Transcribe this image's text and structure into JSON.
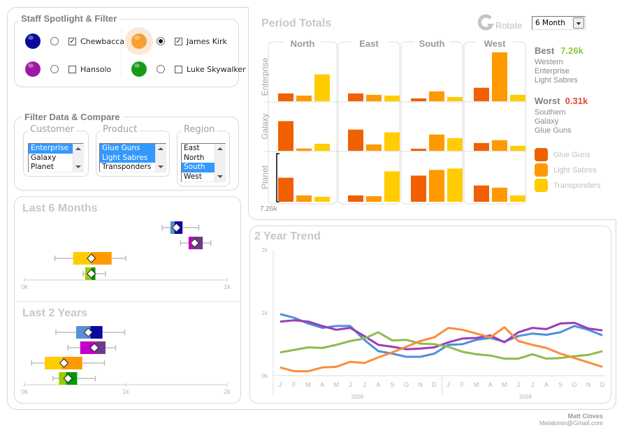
{
  "staff": {
    "title": "Staff Spotlight & Filter",
    "members": [
      {
        "name": "Chewbacca",
        "color": "#0a0a9a",
        "selected": false,
        "checked": true
      },
      {
        "name": "Hansolo",
        "color": "#a018a8",
        "selected": false,
        "checked": false
      },
      {
        "name": "James Kirk",
        "color": "#f5a030",
        "selected": true,
        "checked": true
      },
      {
        "name": "Luke Skywalker",
        "color": "#1a9a1a",
        "selected": false,
        "checked": false
      }
    ],
    "check_mark": "✓"
  },
  "filter": {
    "title": "Filter Data & Compare",
    "customer": {
      "label": "Customer",
      "options": [
        {
          "text": "Enterprise",
          "selected": true
        },
        {
          "text": "Galaxy",
          "selected": false
        },
        {
          "text": "Planet",
          "selected": false
        }
      ]
    },
    "product": {
      "label": "Product",
      "options": [
        {
          "text": "Glue Guns",
          "selected": true
        },
        {
          "text": "Light Sabres",
          "selected": true
        },
        {
          "text": "Transponders",
          "selected": false
        }
      ]
    },
    "region": {
      "label": "Region",
      "options": [
        {
          "text": "East",
          "selected": false
        },
        {
          "text": "North",
          "selected": false
        },
        {
          "text": "South",
          "selected": true
        },
        {
          "text": "West",
          "selected": false
        }
      ]
    }
  },
  "period_totals": {
    "title": "Period Totals",
    "rotate_label": "Rotate",
    "period_select": "6 Month",
    "scale_label": "7.26k",
    "best": {
      "label": "Best",
      "value": "7.26k",
      "lines": [
        "Western",
        "Enterprise",
        "Light Sabres"
      ],
      "color": "#8cc63f"
    },
    "worst": {
      "label": "Worst",
      "value": "0.31k",
      "lines": [
        "Southern",
        "Galaxy",
        "Glue Guns"
      ],
      "color": "#e8443a"
    },
    "legend": [
      {
        "label": "Glue Guns",
        "color": "#f06000"
      },
      {
        "label": "Light Sabres",
        "color": "#ff9900"
      },
      {
        "label": "Transponders",
        "color": "#ffcc00"
      }
    ]
  },
  "box_plots": [
    {
      "title": "Last 6 Months",
      "axis_max": 1,
      "ticks": [
        "0k",
        "1k"
      ]
    },
    {
      "title": "Last 2 Years",
      "axis_max": 2,
      "ticks": [
        "0k",
        "1k",
        "2k"
      ]
    }
  ],
  "trend": {
    "title": "2 Year Trend",
    "y_ticks": [
      "0k",
      "1k",
      "2k"
    ],
    "months": [
      "J",
      "F",
      "M",
      "A",
      "M",
      "J",
      "J",
      "A",
      "S",
      "O",
      "N",
      "D",
      "J",
      "F",
      "M",
      "A",
      "M",
      "J",
      "J",
      "A",
      "S",
      "O",
      "N",
      "D"
    ],
    "years": [
      "2008",
      "2009"
    ]
  },
  "footer": {
    "name": "Matt Cloves",
    "email": "Melatonin@Gmail.com"
  },
  "chart_data": [
    {
      "type": "bar",
      "title": "Period Totals",
      "unit": "k",
      "columns": [
        "North",
        "East",
        "South",
        "West"
      ],
      "rows": [
        "Enterprise",
        "Galaxy",
        "Planet"
      ],
      "series_names": [
        "Glue Guns",
        "Light Sabres",
        "Transponders"
      ],
      "ylim": [
        0,
        7.26
      ],
      "values": {
        "Enterprise": {
          "North": [
            1.16,
            0.84,
            3.99
          ],
          "East": [
            1.16,
            0.95,
            0.84
          ],
          "South": [
            0.42,
            1.47,
            0.63
          ],
          "West": [
            2.0,
            7.26,
            0.95
          ]
        },
        "Galaxy": {
          "North": [
            4.41,
            0.35,
            1.05
          ],
          "East": [
            3.15,
            0.95,
            2.73
          ],
          "South": [
            0.31,
            2.42,
            1.89
          ],
          "West": [
            1.16,
            1.58,
            0.74
          ]
        },
        "Planet": {
          "North": [
            3.57,
            0.95,
            0.74
          ],
          "East": [
            0.95,
            0.84,
            4.52
          ],
          "South": [
            3.89,
            4.73,
            4.94
          ],
          "West": [
            2.42,
            2.1,
            0.95
          ]
        }
      }
    },
    {
      "type": "boxplot",
      "title": "Last 6 Months",
      "xlim": [
        0,
        1
      ],
      "unit": "k",
      "series": [
        {
          "name": "Chewbacca",
          "min": 0.68,
          "q1": 0.72,
          "median": 0.74,
          "q3": 0.78,
          "max": 0.86,
          "mean": 0.75,
          "light": "#5890d8",
          "dark": "#0a0aa0"
        },
        {
          "name": "Hansolo",
          "min": 0.77,
          "q1": 0.81,
          "median": 0.83,
          "q3": 0.88,
          "max": 0.92,
          "mean": 0.84,
          "light": "#c000c8",
          "dark": "#6e3a8a"
        },
        {
          "name": "James Kirk",
          "min": 0.15,
          "q1": 0.24,
          "median": 0.33,
          "q3": 0.43,
          "max": 0.5,
          "mean": 0.33,
          "light": "#ffcc00",
          "dark": "#ff9900"
        },
        {
          "name": "Luke Skywalker",
          "min": 0.29,
          "q1": 0.3,
          "median": 0.33,
          "q3": 0.35,
          "max": 0.4,
          "mean": 0.33,
          "light": "#99cc00",
          "dark": "#009900"
        }
      ]
    },
    {
      "type": "boxplot",
      "title": "Last 2 Years",
      "xlim": [
        0,
        2
      ],
      "unit": "k",
      "series": [
        {
          "name": "Chewbacca",
          "min": 0.31,
          "q1": 0.51,
          "median": 0.65,
          "q3": 0.77,
          "max": 0.99,
          "mean": 0.63,
          "light": "#5890d8",
          "dark": "#0a0aa0"
        },
        {
          "name": "Hansolo",
          "min": 0.43,
          "q1": 0.55,
          "median": 0.71,
          "q3": 0.8,
          "max": 0.9,
          "mean": 0.69,
          "light": "#c000c8",
          "dark": "#6e3a8a"
        },
        {
          "name": "James Kirk",
          "min": 0.07,
          "q1": 0.2,
          "median": 0.37,
          "q3": 0.57,
          "max": 0.79,
          "mean": 0.39,
          "light": "#ffcc00",
          "dark": "#ff9900"
        },
        {
          "name": "Luke Skywalker",
          "min": 0.28,
          "q1": 0.34,
          "median": 0.41,
          "q3": 0.52,
          "max": 0.7,
          "mean": 0.43,
          "light": "#99cc00",
          "dark": "#009900"
        }
      ]
    },
    {
      "type": "line",
      "title": "2 Year Trend",
      "ylim": [
        0,
        2
      ],
      "yunit": "k",
      "x": [
        "Jan 2008",
        "Feb 2008",
        "Mar 2008",
        "Apr 2008",
        "May 2008",
        "Jun 2008",
        "Jul 2008",
        "Aug 2008",
        "Sep 2008",
        "Oct 2008",
        "Nov 2008",
        "Dec 2008",
        "Jan 2009",
        "Feb 2009",
        "Mar 2009",
        "Apr 2009",
        "May 2009",
        "Jun 2009",
        "Jul 2009",
        "Aug 2009",
        "Sep 2009",
        "Oct 2009",
        "Nov 2009",
        "Dec 2009"
      ],
      "series": [
        {
          "name": "Chewbacca",
          "color": "#4f8fdb",
          "values": [
            0.98,
            0.92,
            0.83,
            0.76,
            0.79,
            0.79,
            0.57,
            0.39,
            0.35,
            0.3,
            0.3,
            0.35,
            0.49,
            0.5,
            0.57,
            0.6,
            0.54,
            0.63,
            0.67,
            0.65,
            0.69,
            0.79,
            0.73,
            0.64
          ]
        },
        {
          "name": "Hansolo",
          "color": "#9b3db8",
          "values": [
            0.86,
            0.88,
            0.86,
            0.79,
            0.73,
            0.76,
            0.63,
            0.49,
            0.46,
            0.42,
            0.43,
            0.45,
            0.53,
            0.59,
            0.6,
            0.64,
            0.53,
            0.69,
            0.76,
            0.74,
            0.83,
            0.84,
            0.75,
            0.72
          ]
        },
        {
          "name": "Luke Skywalker",
          "color": "#8fba4f",
          "values": [
            0.37,
            0.41,
            0.45,
            0.44,
            0.49,
            0.55,
            0.59,
            0.69,
            0.56,
            0.57,
            0.51,
            0.5,
            0.46,
            0.38,
            0.34,
            0.32,
            0.27,
            0.27,
            0.34,
            0.27,
            0.28,
            0.31,
            0.33,
            0.39
          ]
        },
        {
          "name": "James Kirk",
          "color": "#fb8c3c",
          "values": [
            0.13,
            0.07,
            0.07,
            0.13,
            0.14,
            0.22,
            0.2,
            0.29,
            0.37,
            0.46,
            0.55,
            0.61,
            0.76,
            0.73,
            0.67,
            0.61,
            0.77,
            0.55,
            0.49,
            0.44,
            0.35,
            0.28,
            0.21,
            0.14
          ]
        }
      ]
    }
  ]
}
